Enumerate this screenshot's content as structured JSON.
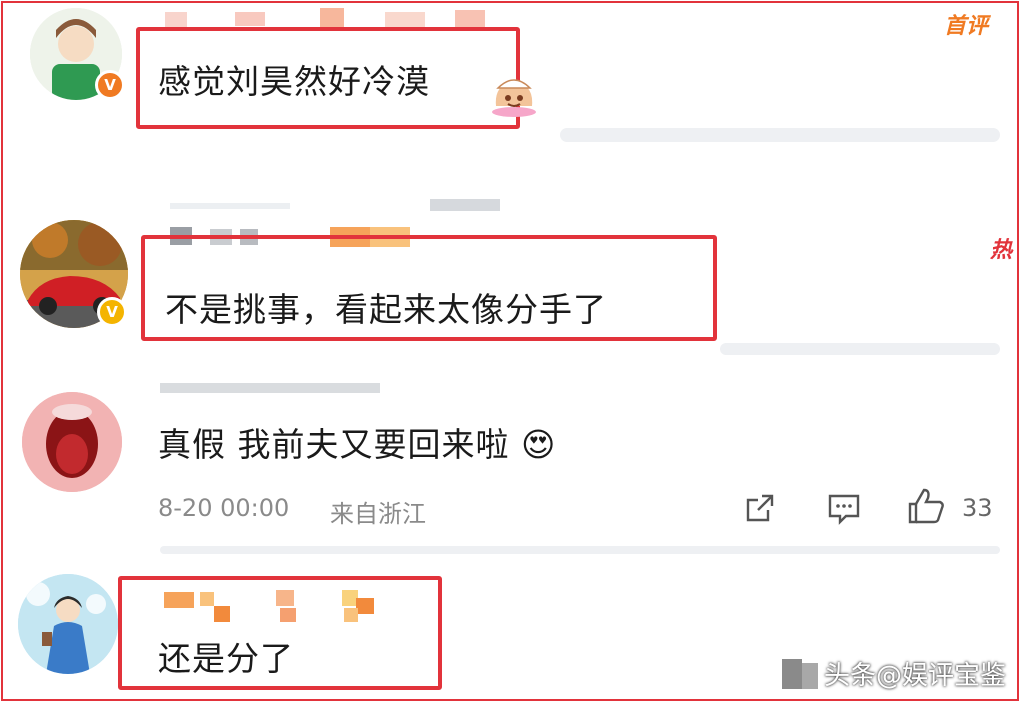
{
  "comments": [
    {
      "text": "感觉刘昊然好冷漠",
      "tag": "首评"
    },
    {
      "text": "不是挑事，看起来太像分手了",
      "tag": "热"
    },
    {
      "text": "真假 我前夫又要回来啦",
      "emoji": "😍",
      "timestamp": "8-20 00:00",
      "location": "来自浙江",
      "like_count": "33"
    },
    {
      "text": "还是分了"
    }
  ],
  "watermark": {
    "text": "头条@娱评宝鉴"
  },
  "colors": {
    "highlight": "#e2333b",
    "verified_gold": "#f4b400",
    "verified_orange": "#f07a22"
  }
}
